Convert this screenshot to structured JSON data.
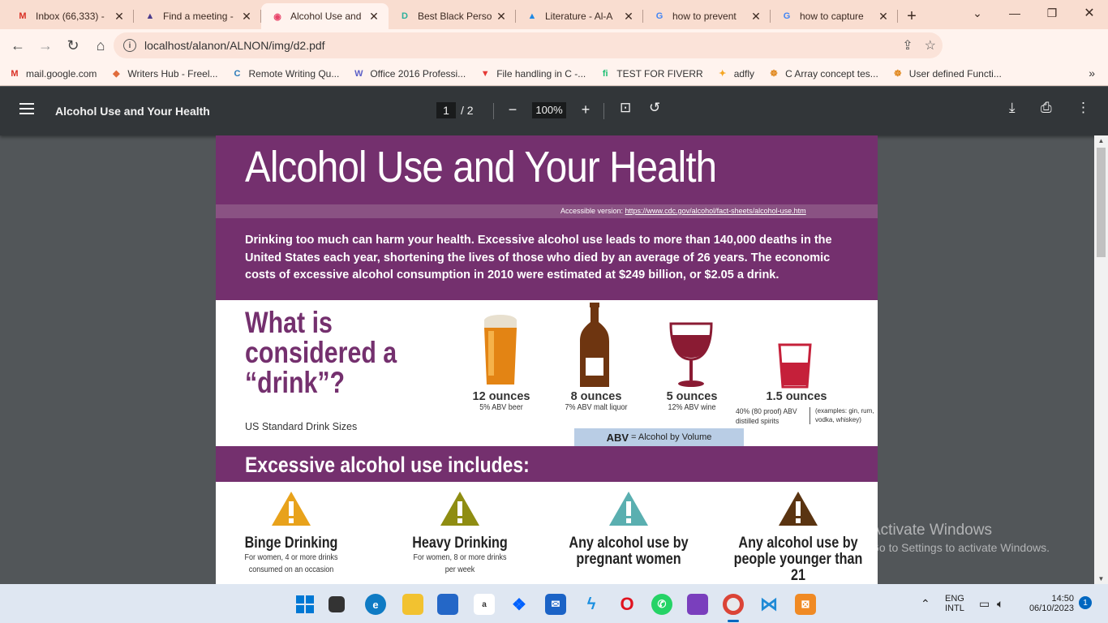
{
  "browser": {
    "tabs": [
      {
        "label": "Inbox (66,333) -",
        "icon": "gmail-icon",
        "color": "#d93025",
        "glyph": "M",
        "active": false
      },
      {
        "label": "Find a meeting -",
        "icon": "triangle-app-icon",
        "color": "#4a3a8c",
        "glyph": "▲",
        "active": false
      },
      {
        "label": "Alcohol Use and",
        "icon": "pdf-tab-icon",
        "color": "#e8456a",
        "glyph": "◉",
        "active": true
      },
      {
        "label": "Best Black Perso",
        "icon": "d-app-icon",
        "color": "#2ab09c",
        "glyph": "D",
        "active": false
      },
      {
        "label": "Literature - Al-A",
        "icon": "literature-icon",
        "color": "#1e88e5",
        "glyph": "▲",
        "active": false
      },
      {
        "label": "how to prevent",
        "icon": "google-icon",
        "color": "#4285f4",
        "glyph": "G",
        "active": false
      },
      {
        "label": "how to capture",
        "icon": "google-icon",
        "color": "#4285f4",
        "glyph": "G",
        "active": false
      }
    ],
    "new_tab": "+",
    "url": "localhost/alanon/ALNON/img/d2.pdf",
    "bookmarks": [
      {
        "label": "mail.google.com",
        "icon": "gmail-icon",
        "glyph": "M",
        "color": "#d93025"
      },
      {
        "label": "Writers Hub - Freel...",
        "icon": "writers-hub-icon",
        "glyph": "◆",
        "color": "#e06c3c"
      },
      {
        "label": "Remote Writing Qu...",
        "icon": "c-app-icon",
        "glyph": "C",
        "color": "#2b7bb9"
      },
      {
        "label": "Office 2016 Professi...",
        "icon": "w-app-icon",
        "glyph": "W",
        "color": "#5b5fc7"
      },
      {
        "label": "File handling in C -...",
        "icon": "down-arrow-red-icon",
        "glyph": "▼",
        "color": "#e53935"
      },
      {
        "label": "TEST FOR FIVERR",
        "icon": "fiverr-icon",
        "glyph": "fi",
        "color": "#1dbf73"
      },
      {
        "label": "adfly",
        "icon": "adfly-icon",
        "glyph": "✦",
        "color": "#f5a623"
      },
      {
        "label": "C Array concept tes...",
        "icon": "c-array-icon",
        "glyph": "☸",
        "color": "#e0861a"
      },
      {
        "label": "User defined Functi...",
        "icon": "user-func-icon",
        "glyph": "☸",
        "color": "#e0861a"
      }
    ],
    "more_bookmarks": "»"
  },
  "pdf": {
    "title": "Alcohol Use and Your Health",
    "current_page": "1",
    "total_pages": "/  2",
    "zoom": "100%"
  },
  "doc": {
    "title": "Alcohol Use and Your Health",
    "accessible_label": "Accessible version: ",
    "accessible_link": "https://www.cdc.gov/alcohol/fact-sheets/alcohol-use.htm",
    "intro": "Drinking too much can harm your health. Excessive alcohol use leads to more than 140,000  deaths in the United States each year, shortening the lives of those who died by an average of 26 years. The economic costs of excessive alcohol consumption in 2010 were estimated at $249 billion, or $2.05 a drink.",
    "drink_heading_1": "What is",
    "drink_heading_2": "considered a",
    "drink_heading_3": "“drink”?",
    "standard_sizes": "US Standard Drink Sizes",
    "drinks": [
      {
        "amount": "12 ounces",
        "desc": "5% ABV beer"
      },
      {
        "amount": "8 ounces",
        "desc": "7% ABV malt liquor"
      },
      {
        "amount": "5 ounces",
        "desc": "12% ABV wine"
      },
      {
        "amount": "1.5 ounces",
        "desc": ""
      }
    ],
    "spirits_line1": "40% (80 proof)  ABV",
    "spirits_line2": "distilled spirits",
    "examples": "(examples: gin, rum, vodka, whiskey)",
    "abv_abbr": "ABV",
    "abv_def": "= Alcohol by Volume",
    "excessive_heading": "Excessive alcohol use includes:",
    "warnings": [
      {
        "title": "Binge Drinking",
        "desc1": "For women, 4 or more drinks",
        "desc2": "consumed on an occasion",
        "color": "#e8a21b"
      },
      {
        "title": "Heavy Drinking",
        "desc1": "For women, 8 or more drinks",
        "desc2": "per week",
        "color": "#8f8d12"
      },
      {
        "title": "Any alcohol use by",
        "title2": "pregnant women",
        "color": "#5aafb0"
      },
      {
        "title": "Any alcohol use by",
        "title2": "people younger than",
        "title3": "21",
        "color": "#5a3411"
      }
    ]
  },
  "watermark": {
    "line1": "Activate Windows",
    "line2": "Go to Settings to activate Windows."
  },
  "taskbar": {
    "lang1": "ENG",
    "lang2": "INTL",
    "time": "14:50",
    "date": "06/10/2023",
    "notifications": "1"
  }
}
